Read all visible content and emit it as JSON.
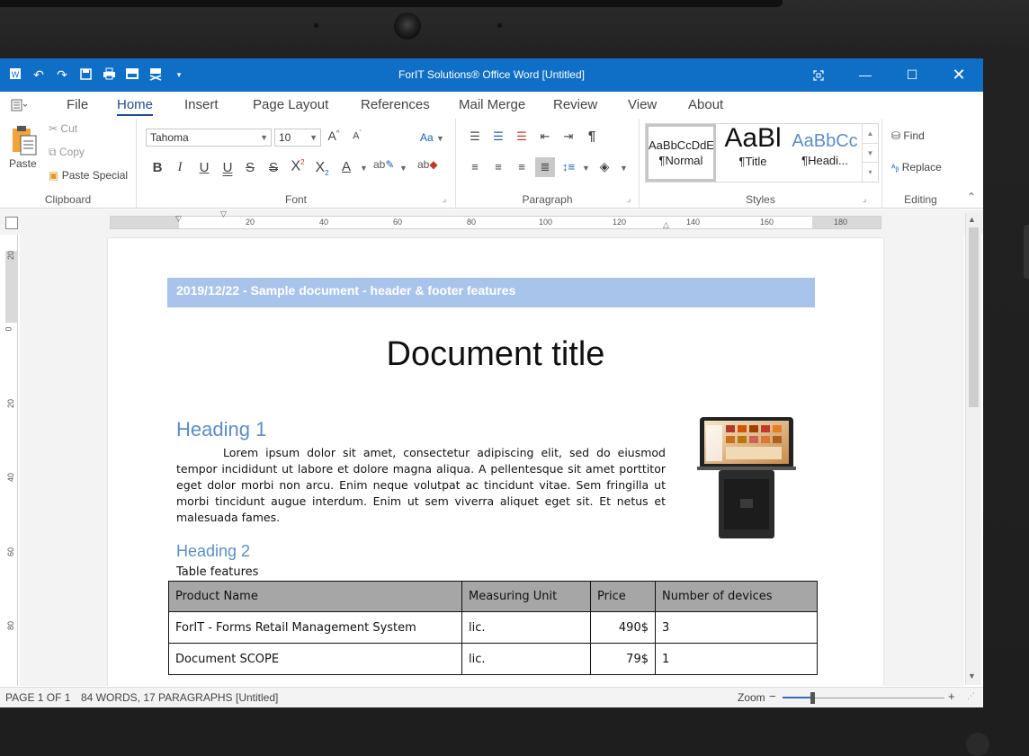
{
  "app": {
    "title": "ForIT Solutions® Office Word [Untitled]"
  },
  "quick_access": {
    "icons": [
      "word-app-icon",
      "undo-icon",
      "redo-icon",
      "save-icon",
      "print-icon",
      "pdf-export-icon",
      "pdf-mail-icon",
      "customize-dropdown-icon"
    ]
  },
  "tabs": [
    {
      "label": "File"
    },
    {
      "label": "Home",
      "active": true
    },
    {
      "label": "Insert"
    },
    {
      "label": "Page Layout"
    },
    {
      "label": "References"
    },
    {
      "label": "Mail Merge"
    },
    {
      "label": "Review"
    },
    {
      "label": "View"
    },
    {
      "label": "About"
    }
  ],
  "clipboard": {
    "paste": "Paste",
    "cut": "Cut",
    "copy": "Copy",
    "paste_special": "Paste Special",
    "label": "Clipboard"
  },
  "font": {
    "name": "Tahoma",
    "size": "10",
    "label": "Font",
    "change_case": "Aa"
  },
  "paragraph": {
    "label": "Paragraph"
  },
  "styles": {
    "label": "Styles",
    "items": [
      {
        "sample": "AaBbCcDdE",
        "name": "¶Normal"
      },
      {
        "sample": "AaBl",
        "name": "¶Title"
      },
      {
        "sample": "AaBbCc",
        "name": "¶Headi..."
      }
    ]
  },
  "editing": {
    "find": "Find",
    "replace": "Replace",
    "label": "Editing"
  },
  "ruler": {
    "ticks": [
      "20",
      "40",
      "60",
      "80",
      "100",
      "120",
      "140",
      "160",
      "180"
    ],
    "vticks": [
      "20",
      "0",
      "20",
      "40",
      "60",
      "80"
    ]
  },
  "document": {
    "header": "2019/12/22 - Sample document - header & footer features",
    "title": "Document title",
    "heading1": "Heading 1",
    "paragraph": "Lorem ipsum dolor sit amet, consectetur adipiscing elit, sed do eiusmod tempor incididunt ut labore et dolore magna aliqua. A pellentesque sit amet porttitor eget dolor morbi non arcu. Enim neque volutpat ac tincidunt vitae. Sem fringilla ut morbi tincidunt augue interdum. Enim ut sem viverra aliquet eget sit. Et netus et malesuada fames.",
    "heading2": "Heading 2",
    "table_caption": "Table features",
    "table": {
      "headers": [
        "Product Name",
        "Measuring Unit",
        "Price",
        "Number of devices"
      ],
      "rows": [
        [
          "ForIT - Forms Retail Management System",
          "lic.",
          "490$",
          "3"
        ],
        [
          "Document SCOPE",
          "lic.",
          "79$",
          "1"
        ]
      ]
    }
  },
  "status": {
    "page": "PAGE 1 OF 1",
    "words": "84 WORDS, 17 PARAGRAPHS",
    "doc": "[Untitled]",
    "zoom_label": "Zoom",
    "zoom_minus": "−",
    "zoom_plus": "+"
  },
  "colors": {
    "titlebar": "#0f6fc6",
    "header_band": "#a9c4ea",
    "heading": "#5b8ec6",
    "table_header": "#a6a6a6"
  }
}
